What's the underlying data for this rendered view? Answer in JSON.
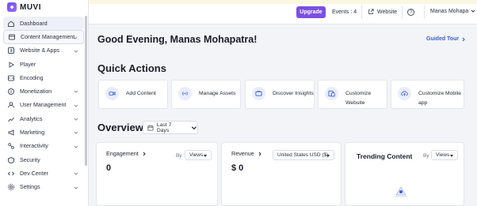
{
  "app": {
    "logo_text": "MUVI"
  },
  "sidebar": {
    "items": [
      {
        "label": "Dashboard",
        "icon": "home-icon",
        "active": true,
        "chevron": false
      },
      {
        "label": "Content Management",
        "icon": "content-icon",
        "chevron": true
      },
      {
        "label": "Website & Apps",
        "icon": "website-apps-icon",
        "chevron": true
      },
      {
        "label": "Player",
        "icon": "play-icon",
        "chevron": false
      },
      {
        "label": "Encoding",
        "icon": "encoding-icon",
        "chevron": false
      },
      {
        "label": "Monetization",
        "icon": "monetization-icon",
        "chevron": true
      },
      {
        "label": "User Management",
        "icon": "users-icon",
        "chevron": true
      },
      {
        "label": "Analytics",
        "icon": "analytics-icon",
        "chevron": true
      },
      {
        "label": "Marketing",
        "icon": "marketing-icon",
        "chevron": true
      },
      {
        "label": "Interactivity",
        "icon": "interactivity-icon",
        "chevron": true
      },
      {
        "label": "Security",
        "icon": "security-icon",
        "chevron": false
      },
      {
        "label": "Dev Center",
        "icon": "code-icon",
        "chevron": true
      },
      {
        "label": "Settings",
        "icon": "gear-icon",
        "chevron": true
      }
    ]
  },
  "topbar": {
    "upgrade_label": "Upgrade",
    "events_label": "Events : 4",
    "website_label": "Website",
    "user_name": "Manas Mohapa"
  },
  "main": {
    "greeting": "Good Evening, Manas Mohapatra!",
    "guided_tour": "Guided Tour",
    "quick_actions_title": "Quick Actions",
    "quick_actions": [
      {
        "label": "Add Content",
        "icon": "video-icon"
      },
      {
        "label": "Manage Assets",
        "icon": "broadcast-icon"
      },
      {
        "label": "Discover Insights",
        "icon": "tv-icon"
      },
      {
        "label": "Customize Website",
        "icon": "device-icon"
      },
      {
        "label": "Customize Mobile app",
        "icon": "upload-cloud-icon"
      }
    ],
    "overview_title": "Overview",
    "period": "Last 7 Days",
    "engagement": {
      "title": "Engagement",
      "value": "0",
      "by": "By",
      "select": "Views"
    },
    "revenue": {
      "title": "Revenue",
      "value": "$ 0",
      "currency": "United States USD ($)"
    },
    "trending": {
      "title": "Trending Content",
      "by": "By",
      "select": "Views"
    }
  },
  "colors": {
    "accent": "#7b4fe0",
    "link": "#3a5fd0",
    "background": "#f3f4f7"
  }
}
